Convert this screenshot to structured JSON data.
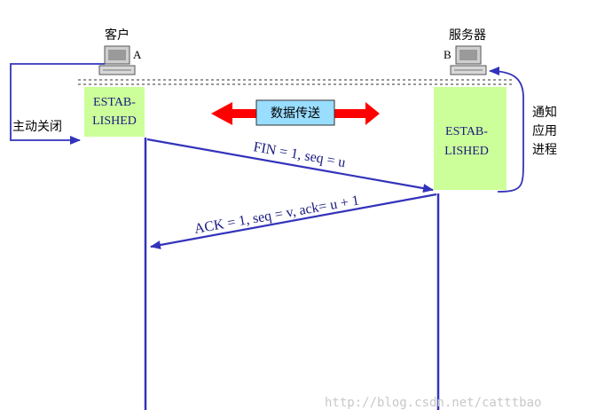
{
  "client": {
    "title": "客户",
    "letter": "A",
    "state_line1": "ESTAB-",
    "state_line2": "LISHED"
  },
  "server": {
    "title": "服务器",
    "letter": "B",
    "state_line1": "ESTAB-",
    "state_line2": "LISHED"
  },
  "active_close_label": "主动关闭",
  "notify_label": [
    "通知",
    "应用",
    "进程"
  ],
  "data_transfer_label": "数据传送",
  "messages": {
    "fin": "FIN = 1, seq = u",
    "ack": "ACK = 1, seq = v, ack= u + 1"
  },
  "watermark": "http://blog.csdn.net/catttbao",
  "colors": {
    "arrow": "#3333bb",
    "state_box": "#ccff99",
    "data_arrow": "#ff0000",
    "data_box": "#99ddff"
  }
}
